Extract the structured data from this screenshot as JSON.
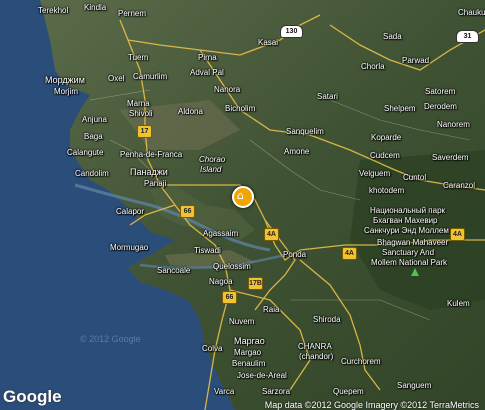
{
  "places": {
    "terekhol": "Terekhol",
    "kindla": "Kindla",
    "pernem": "Pernem",
    "kasai": "Kasai",
    "sada": "Sada",
    "chaukul": "Chaukul",
    "morjim_ru": "Морджим",
    "morjim": "Morjim",
    "oxel": "Oxel",
    "camurlim": "Camurlim",
    "tuem": "Tuem",
    "pirna": "Pirna",
    "adval_pal": "Adval Pal",
    "chorla": "Chorla",
    "parwad": "Parwad",
    "satorem": "Satorem",
    "derodem": "Derodem",
    "satari": "Satari",
    "shelpem": "Shelpem",
    "nanorem": "Nanorem",
    "marna": "Marna",
    "shivoli": "Shivoli",
    "anjuna": "Anjuna",
    "aldona": "Aldona",
    "bicholim": "Bicholim",
    "nanora": "Nanora",
    "baga": "Baga",
    "sanquelim": "Sanquelim",
    "koparde": "Koparde",
    "calangute": "Calangute",
    "penha_de_franca": "Penha-de-Franca",
    "chorao": "Chorao",
    "island": "Island",
    "amone": "Amone",
    "cudcem": "Cudcem",
    "saverdem": "Saverdem",
    "candolim": "Candolim",
    "panaji_ru": "Панаджи",
    "panaji": "Panaji",
    "velguem": "Velguem",
    "cuntol": "Cuntol",
    "khotodem": "khotodem",
    "caranzol": "Caranzol",
    "park_ru_1": "Национальный парк",
    "park_ru_2": "Бхагван Махевир",
    "park_ru_3": "Санкчури Энд Моллем",
    "park_en_1": "Bhagwan Mahaveer",
    "park_en_2": "Sanctuary And",
    "park_en_3": "Mollem National Park",
    "calapor": "Calapor",
    "agassaim": "Agassaim",
    "mormugao": "Mormugao",
    "tiswadi": "Tiswadi",
    "ponda": "Ponda",
    "sancoale": "Sancoale",
    "quelossim": "Quelossim",
    "nagoa": "Nagoa",
    "kulem": "Kulem",
    "raia": "Raia",
    "nuvem": "Nuvem",
    "shiroda": "Shiroda",
    "colva": "Colva",
    "margao_ru": "Маргао",
    "margao": "Margao",
    "chanra": "CHANRA",
    "chandor": "(chandor)",
    "curchorem": "Curchorem",
    "benaulim": "Benaulim",
    "jose_de_areal": "Jose-de-Areal",
    "sanguem": "Sanguem",
    "varca": "Varca",
    "sarzora": "Sarzora",
    "quepem": "Quepem"
  },
  "shields": {
    "s17a": "17",
    "s66a": "66",
    "s4a_1": "4A",
    "s4a_2": "4A",
    "s4a_3": "4A",
    "s17b": "17B",
    "s66b": "66",
    "nh130": "130",
    "nh31": "31"
  },
  "watermark": "© 2012 Google",
  "logo": "Google",
  "attribution": "Map data ©2012 Google  Imagery ©2012 TerraMetrics",
  "colors": {
    "sea": "#2a4d7a",
    "land": "#4a5a3a",
    "roads": "#f2c94c"
  }
}
